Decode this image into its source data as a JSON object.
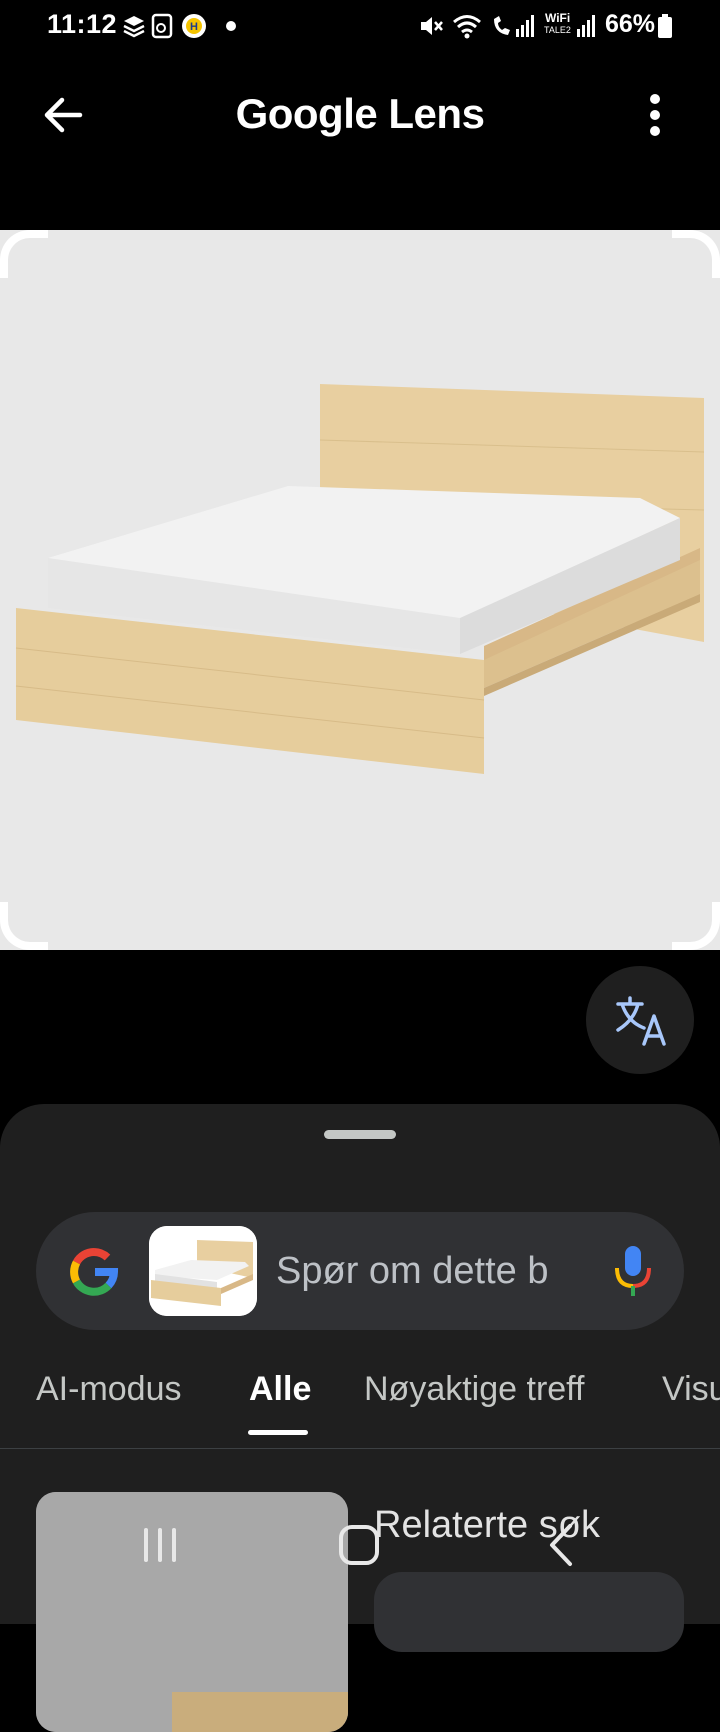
{
  "status_bar": {
    "time": "11:12",
    "wifi_label_top": "WiFi",
    "wifi_label_bottom": "TALE2",
    "battery_pct": "66%"
  },
  "app_bar": {
    "title": "Google Lens"
  },
  "search": {
    "placeholder": "Spør om dette b"
  },
  "tabs": [
    {
      "label": "AI-modus"
    },
    {
      "label": "Alle"
    },
    {
      "label": "Nøyaktige treff"
    },
    {
      "label": "Visu"
    }
  ],
  "results": {
    "related_title": "Relaterte søk"
  },
  "colors": {
    "background": "#000000",
    "sheet": "#1f1f1f",
    "search_bar": "#303134",
    "google_blue": "#4285f4",
    "google_red": "#ea4335",
    "google_yellow": "#fbbc05",
    "google_green": "#34a853",
    "wood": "#e6cd9c"
  },
  "icons": {
    "back": "arrow-left-icon",
    "more": "more-vert-icon",
    "translate": "translate-icon",
    "mic": "mic-icon",
    "google": "google-g-icon",
    "nav_recents": "recents-icon",
    "nav_home": "home-icon",
    "nav_back": "back-icon"
  }
}
